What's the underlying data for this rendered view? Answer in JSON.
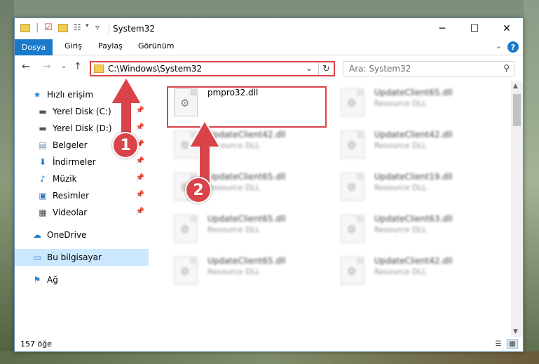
{
  "window": {
    "title": "System32",
    "controls": {
      "minimize": "─",
      "maximize": "☐",
      "close": "✕"
    }
  },
  "ribbon": {
    "file_tab": "Dosya",
    "tabs": [
      "Giriş",
      "Paylaş",
      "Görünüm"
    ]
  },
  "address": {
    "path": "C:\\Windows\\System32",
    "search_placeholder": "Ara: System32"
  },
  "sidebar": {
    "items": [
      {
        "label": "Hızlı erişim",
        "icon": "star-icon"
      },
      {
        "label": "Yerel Disk (C:)",
        "icon": "drive-icon",
        "pinned": true
      },
      {
        "label": "Yerel Disk (D:)",
        "icon": "drive-icon",
        "pinned": true
      },
      {
        "label": "Belgeler",
        "icon": "documents-icon",
        "pinned": true
      },
      {
        "label": "İndirmeler",
        "icon": "download-icon",
        "pinned": true
      },
      {
        "label": "Müzik",
        "icon": "music-icon",
        "pinned": true
      },
      {
        "label": "Resimler",
        "icon": "pictures-icon",
        "pinned": true
      },
      {
        "label": "Videolar",
        "icon": "videos-icon",
        "pinned": true
      },
      {
        "label": "OneDrive",
        "icon": "cloud-icon"
      },
      {
        "label": "Bu bilgisayar",
        "icon": "computer-icon",
        "selected": true
      },
      {
        "label": "Ağ",
        "icon": "network-icon"
      }
    ]
  },
  "files": [
    {
      "name": "pmpro32.dll",
      "type": ""
    },
    {
      "name": "UpdateClient65.dll",
      "type": "Resource DLL"
    },
    {
      "name": "UpdateClient42.dll",
      "type": "Resource DLL"
    },
    {
      "name": "UpdateClient42.dll",
      "type": "Resource DLL"
    },
    {
      "name": "UpdateClient65.dll",
      "type": "Resource DLL"
    },
    {
      "name": "UpdateClient19.dll",
      "type": "Resource DLL"
    },
    {
      "name": "UpdateClient65.dll",
      "type": "Resource DLL"
    },
    {
      "name": "UpdateClient63.dll",
      "type": "Resource DLL"
    },
    {
      "name": "UpdateClient65.dll",
      "type": "Resource DLL"
    },
    {
      "name": "UpdateClient42.dll",
      "type": "Resource DLL"
    }
  ],
  "status": {
    "count": "157 öğe"
  },
  "annotations": {
    "step1": "1",
    "step2": "2"
  },
  "colors": {
    "accent": "#1979ca",
    "highlight": "#d9444a",
    "selection": "#cce8ff"
  }
}
